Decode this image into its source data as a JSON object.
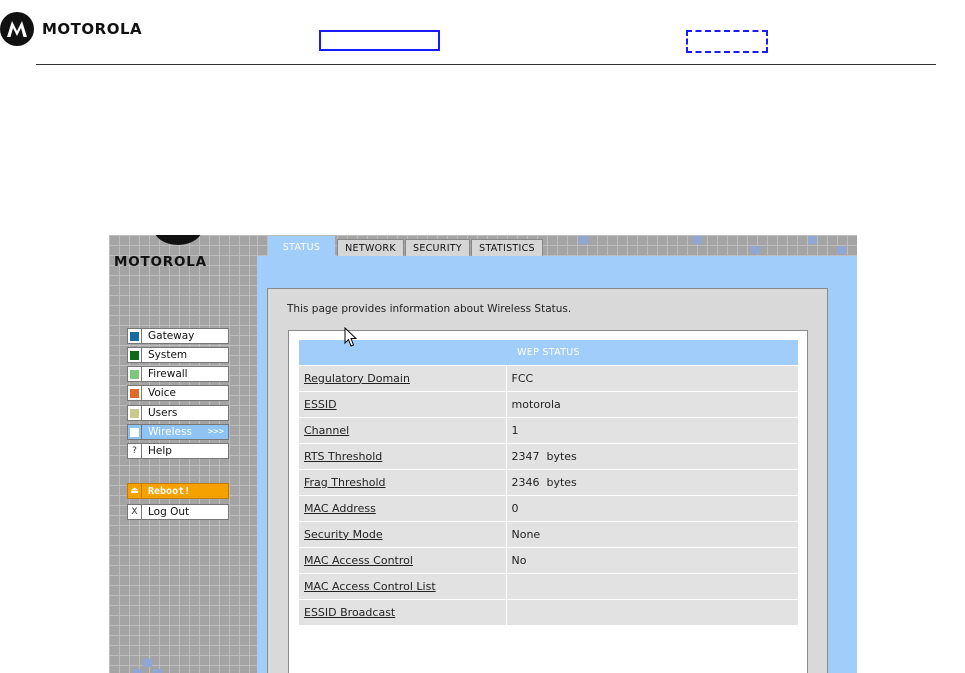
{
  "header": {
    "brand": "MOTOROLA"
  },
  "router": {
    "brand": "MOTOROLA",
    "tabs": [
      {
        "label": "STATUS",
        "active": true
      },
      {
        "label": "NETWORK",
        "active": false
      },
      {
        "label": "SECURITY",
        "active": false
      },
      {
        "label": "STATISTICS",
        "active": false
      }
    ],
    "menu": [
      {
        "label": "Gateway",
        "color": "#1a6aa0",
        "glyph": ""
      },
      {
        "label": "System",
        "color": "#0d6b1a",
        "glyph": ""
      },
      {
        "label": "Firewall",
        "color": "#7ec77e",
        "glyph": ""
      },
      {
        "label": "Voice",
        "color": "#e06a28",
        "glyph": ""
      },
      {
        "label": "Users",
        "color": "#c9c98e",
        "glyph": ""
      },
      {
        "label": "Wireless",
        "color": "#ffffff",
        "glyph": "",
        "active": true,
        "chevron": ">>>"
      },
      {
        "label": "Help",
        "color": "",
        "glyph": "?"
      },
      {
        "label": "Reboot!",
        "color": "",
        "glyph": "⏏"
      },
      {
        "label": "Log Out",
        "color": "",
        "glyph": "X"
      }
    ],
    "intro": "This page provides information about Wireless Status.",
    "table": {
      "title": "WEP STATUS",
      "rows": [
        {
          "label": "Regulatory Domain",
          "value": "FCC"
        },
        {
          "label": "ESSID",
          "value": "motorola"
        },
        {
          "label": "Channel",
          "value": "1"
        },
        {
          "label": "RTS Threshold",
          "value": "2347  bytes"
        },
        {
          "label": "Frag Threshold",
          "value": "2346  bytes"
        },
        {
          "label": "MAC Address",
          "value": "0"
        },
        {
          "label": "Security Mode",
          "value": "None"
        },
        {
          "label": "MAC Access Control",
          "value": "No"
        },
        {
          "label": "MAC Access Control List",
          "value": ""
        },
        {
          "label": "ESSID Broadcast",
          "value": ""
        }
      ]
    }
  },
  "colors": {
    "accent_blue": "#a1cdfb",
    "reboot_orange": "#f5a100",
    "sidebar_gray": "#a4a4a4",
    "annotation_blue": "#1a1aff"
  }
}
